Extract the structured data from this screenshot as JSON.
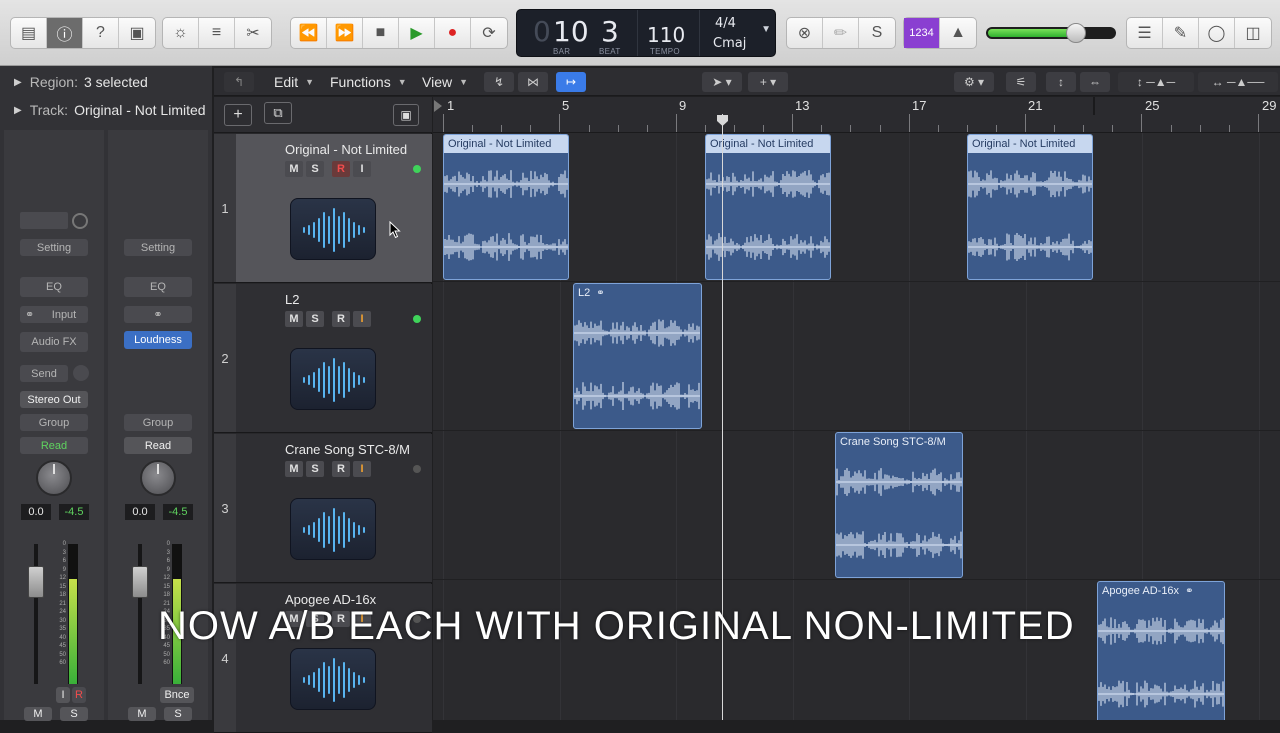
{
  "lcd": {
    "bar_lead": "0",
    "bar": "10",
    "beat": "3",
    "bar_label": "BAR",
    "beat_label": "BEAT",
    "tempo": "110",
    "tempo_label": "TEMPO",
    "signature": "4/4",
    "key": "Cmaj"
  },
  "controlbar": {
    "count_in": "1234"
  },
  "inspector": {
    "region_label": "Region:",
    "region_value": "3 selected",
    "track_label": "Track:",
    "track_value": "Original - Not Limited",
    "strip1": {
      "setting": "Setting",
      "eq": "EQ",
      "input": "Input",
      "audio_fx": "Audio FX",
      "send": "Send",
      "output": "Stereo Out",
      "group": "Group",
      "automation": "Read",
      "vol": "0.0",
      "peak": "-4.5",
      "btn_i": "I",
      "btn_r": "R",
      "mute": "M",
      "solo": "S"
    },
    "strip2": {
      "setting": "Setting",
      "eq": "EQ",
      "plugin": "Loudness",
      "group": "Group",
      "automation": "Read",
      "vol": "0.0",
      "peak": "-4.5",
      "bnce": "Bnce",
      "mute": "M",
      "solo": "S"
    },
    "meter_scale": [
      "0",
      "3",
      "6",
      "9",
      "12",
      "15",
      "18",
      "21",
      "24",
      "30",
      "35",
      "40",
      "45",
      "50",
      "60"
    ]
  },
  "toolbar": {
    "edit": "Edit",
    "functions": "Functions",
    "view": "View"
  },
  "tracks": [
    {
      "num": "1",
      "name": "Original - Not Limited",
      "m": "M",
      "s": "S",
      "r": "R",
      "i": "I"
    },
    {
      "num": "2",
      "name": "L2",
      "m": "M",
      "s": "S",
      "r": "R",
      "i": "I"
    },
    {
      "num": "3",
      "name": "Crane Song STC-8/M",
      "m": "M",
      "s": "S",
      "r": "R",
      "i": "I"
    },
    {
      "num": "4",
      "name": "Apogee AD-16x",
      "m": "M",
      "s": "S",
      "r": "R",
      "i": "I"
    }
  ],
  "ruler": [
    "1",
    "5",
    "9",
    "13",
    "17",
    "21",
    "25",
    "29"
  ],
  "regions": [
    {
      "name": "Original - Not Limited"
    },
    {
      "name": "Original - Not Limited"
    },
    {
      "name": "Original - Not Limited"
    },
    {
      "name": "L2"
    },
    {
      "name": "Crane Song STC-8/M"
    },
    {
      "name": "Apogee AD-16x"
    }
  ],
  "caption": "NOW A/B EACH WITH ORIGINAL NON-LIMITED",
  "colors": {
    "accent": "#3a7be8",
    "region": "#3c5a8a",
    "selected_region_header": "#c7d7ef",
    "play": "#2a9a2a",
    "record": "#dd2222",
    "count_in": "#8a3fd1"
  }
}
